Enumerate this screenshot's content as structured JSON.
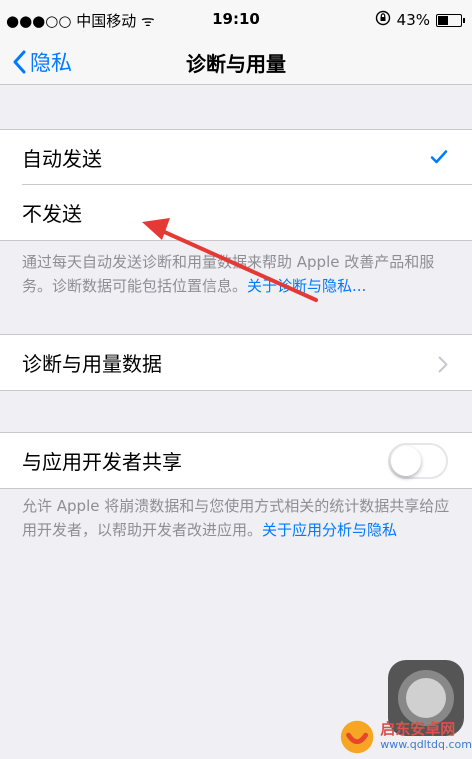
{
  "status_bar": {
    "carrier": "●●●○○ 中国移动 ᯤ",
    "time": "19:10",
    "battery_text": "43%",
    "battery_level": 0.43
  },
  "nav": {
    "back_label": "隐私",
    "title": "诊断与用量"
  },
  "send_options": [
    {
      "label": "自动发送",
      "selected": true
    },
    {
      "label": "不发送",
      "selected": false
    }
  ],
  "send_footer": {
    "text": "通过每天自动发送诊断和用量数据来帮助 Apple 改善产品和服务。诊断数据可能包括位置信息。",
    "link": "关于诊断与隐私..."
  },
  "diagnostics_row": {
    "label": "诊断与用量数据"
  },
  "share_row": {
    "label": "与应用开发者共享",
    "enabled": false
  },
  "share_footer": {
    "text": "允许 Apple 将崩溃数据和与您使用方式相关的统计数据共享给应用开发者，以帮助开发者改进应用。",
    "link": "关于应用分析与隐私"
  },
  "watermark": {
    "name": "启东安卓网",
    "url": "www.qdltdq.com"
  },
  "colors": {
    "accent": "#007aff",
    "annotation_arrow": "#e53935",
    "background": "#efeff4"
  }
}
